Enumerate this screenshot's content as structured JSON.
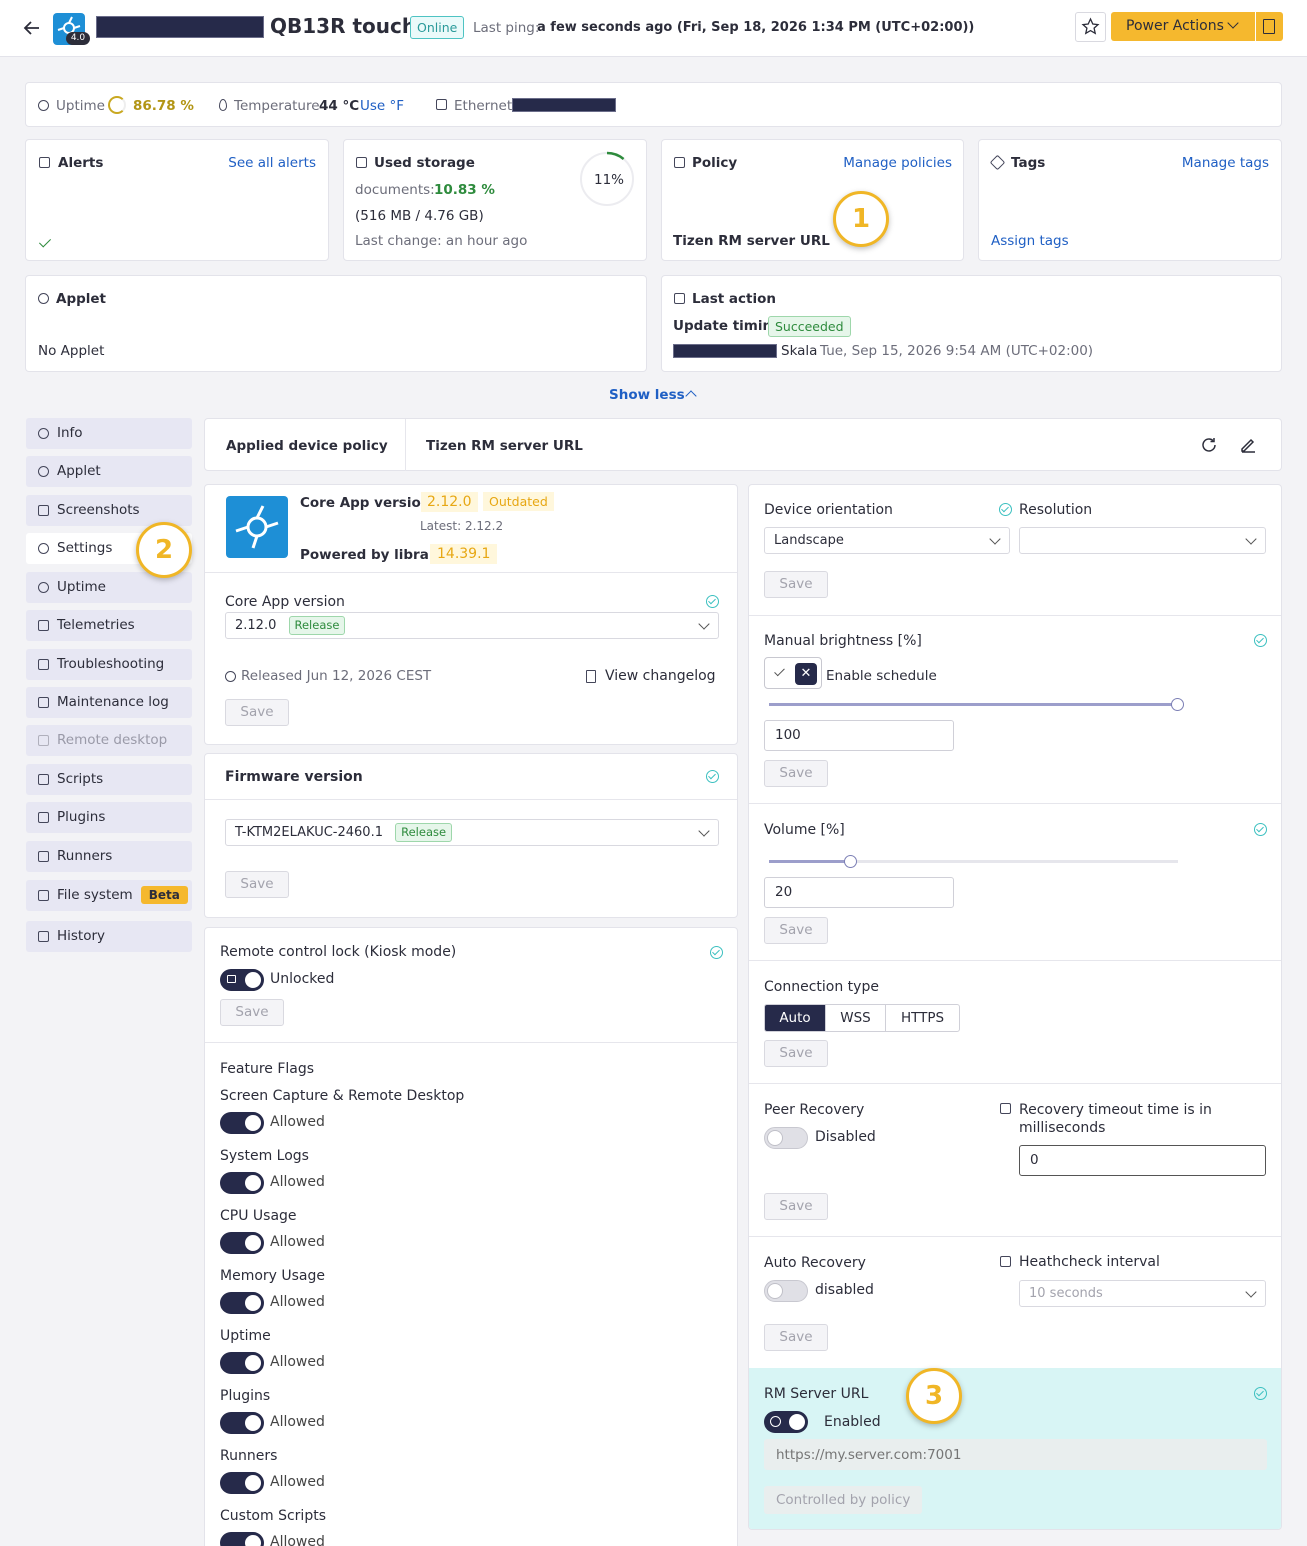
{
  "header": {
    "device_name": "QB13R touch",
    "logo_version": "4.0",
    "status": "Online",
    "last_ping_label": "Last ping:",
    "last_ping_value": "a few seconds ago (Fri, Sep 18, 2026 1:34 PM (UTC+02:00))",
    "power_actions": "Power Actions"
  },
  "stats": {
    "uptime_label": "Uptime",
    "uptime_value": "86.78 %",
    "temperature_label": "Temperature",
    "temperature_value": "44 °C",
    "temperature_toggle": "Use °F",
    "ethernet_label": "Ethernet"
  },
  "alerts": {
    "title": "Alerts",
    "link": "See all alerts"
  },
  "storage": {
    "title": "Used storage",
    "documents_label": "documents:",
    "documents_value": "10.83 %",
    "size": "(516 MB / 4.76 GB)",
    "last_change": "Last change: an hour ago",
    "gauge": "11%",
    "gauge_fraction": 0.11
  },
  "policy": {
    "title": "Policy",
    "link": "Manage policies",
    "value": "Tizen RM server URL"
  },
  "tags": {
    "title": "Tags",
    "link": "Manage tags",
    "assign": "Assign tags"
  },
  "applet": {
    "title": "Applet",
    "value": "No Applet"
  },
  "last_action": {
    "title": "Last action",
    "action": "Update timing",
    "status": "Succeeded",
    "user": "Skala",
    "date": "Tue, Sep 15, 2026 9:54 AM (UTC+02:00)"
  },
  "show_less": "Show less",
  "nav": [
    {
      "label": "Info",
      "icon": "info-icon"
    },
    {
      "label": "Applet",
      "icon": "play-icon"
    },
    {
      "label": "Screenshots",
      "icon": "camera-icon"
    },
    {
      "label": "Settings",
      "icon": "gear-icon"
    },
    {
      "label": "Uptime",
      "icon": "clock-icon"
    },
    {
      "label": "Telemetries",
      "icon": "chart-icon"
    },
    {
      "label": "Troubleshooting",
      "icon": "bug-icon"
    },
    {
      "label": "Maintenance log",
      "icon": "log-icon"
    },
    {
      "label": "Remote desktop",
      "icon": "desktop-icon"
    },
    {
      "label": "Scripts",
      "icon": "terminal-icon"
    },
    {
      "label": "Plugins",
      "icon": "plug-icon"
    },
    {
      "label": "Runners",
      "icon": "refresh-icon"
    },
    {
      "label": "File system",
      "icon": "folder-icon",
      "badge": "Beta"
    },
    {
      "label": "History",
      "icon": "history-icon"
    }
  ],
  "applied_policy": {
    "label": "Applied device policy",
    "value": "Tizen RM server URL"
  },
  "core_app": {
    "version_label": "Core App version:",
    "version": "2.12.0",
    "outdated": "Outdated",
    "latest": "Latest: 2.12.2",
    "library_label": "Powered by library:",
    "library": "14.39.1",
    "select_label": "Core App version",
    "select_value": "2.12.0",
    "select_badge": "Release",
    "released": "Released Jun 12, 2026 CEST",
    "changelog": "View changelog",
    "save": "Save"
  },
  "firmware": {
    "title": "Firmware version",
    "value": "T-KTM2ELAKUC-2460.1",
    "badge": "Release",
    "save": "Save"
  },
  "kiosk": {
    "title": "Remote control lock (Kiosk mode)",
    "state": "Unlocked",
    "save": "Save"
  },
  "feature_flags": {
    "title": "Feature Flags",
    "items": [
      {
        "name": "Screen Capture & Remote Desktop",
        "state": "Allowed"
      },
      {
        "name": "System Logs",
        "state": "Allowed"
      },
      {
        "name": "CPU Usage",
        "state": "Allowed"
      },
      {
        "name": "Memory Usage",
        "state": "Allowed"
      },
      {
        "name": "Uptime",
        "state": "Allowed"
      },
      {
        "name": "Plugins",
        "state": "Allowed"
      },
      {
        "name": "Runners",
        "state": "Allowed"
      },
      {
        "name": "Custom Scripts",
        "state": "Allowed"
      }
    ]
  },
  "orientation": {
    "label": "Device orientation",
    "value": "Landscape",
    "resolution_label": "Resolution",
    "save": "Save"
  },
  "brightness": {
    "label": "Manual brightness [%]",
    "schedule": "Enable schedule",
    "value": "100",
    "level": 1.0,
    "save": "Save"
  },
  "volume": {
    "label": "Volume [%]",
    "value": "20",
    "level": 0.2,
    "save": "Save"
  },
  "connection": {
    "label": "Connection type",
    "options": [
      "Auto",
      "WSS",
      "HTTPS"
    ],
    "selected": "Auto",
    "save": "Save"
  },
  "peer_recovery": {
    "label": "Peer Recovery",
    "state": "Disabled",
    "timeout_label": "Recovery timeout time is in milliseconds",
    "timeout_value": "0",
    "save": "Save"
  },
  "auto_recovery": {
    "label": "Auto Recovery",
    "state": "disabled",
    "interval_label": "Heathcheck interval",
    "interval_value": "10 seconds",
    "save": "Save"
  },
  "rm_server": {
    "label": "RM Server URL",
    "state": "Enabled",
    "placeholder": "https://my.server.com:7001",
    "controlled": "Controlled by policy"
  },
  "annotations": [
    "1",
    "2",
    "3"
  ],
  "colors": {
    "accent": "#f5b82e",
    "navy": "#262a4a",
    "link": "#1f5fc4",
    "highlight": "#d8f5f5"
  }
}
